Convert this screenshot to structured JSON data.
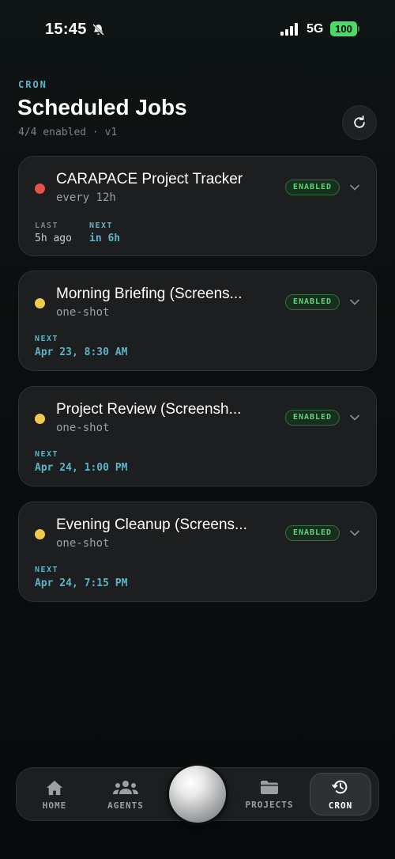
{
  "status_bar": {
    "time": "15:45",
    "network": "5G",
    "battery": "100"
  },
  "header": {
    "eyebrow": "CRON",
    "title": "Scheduled Jobs",
    "subtitle": "4/4 enabled · v1"
  },
  "jobs": [
    {
      "name": "CARAPACE Project Tracker",
      "schedule": "every 12h",
      "status": "ENABLED",
      "dot_color": "#e5534b",
      "last_label": "LAST",
      "last_value": "5h ago",
      "next_label": "NEXT",
      "next_value": "in 6h"
    },
    {
      "name": "Morning Briefing (Screens...",
      "schedule": "one-shot",
      "status": "ENABLED",
      "dot_color": "#f2c94c",
      "next_label": "NEXT",
      "next_value": "Apr 23, 8:30 AM"
    },
    {
      "name": "Project Review (Screensh...",
      "schedule": "one-shot",
      "status": "ENABLED",
      "dot_color": "#f2c94c",
      "next_label": "NEXT",
      "next_value": "Apr 24, 1:00 PM"
    },
    {
      "name": "Evening Cleanup (Screens...",
      "schedule": "one-shot",
      "status": "ENABLED",
      "dot_color": "#f2c94c",
      "next_label": "NEXT",
      "next_value": "Apr 24, 7:15 PM"
    }
  ],
  "tabbar": {
    "home": {
      "label": "HOME",
      "icon": "home-icon"
    },
    "agents": {
      "label": "AGENTS",
      "icon": "people-icon"
    },
    "projects": {
      "label": "PROJECTS",
      "icon": "folder-icon"
    },
    "cron": {
      "label": "CRON",
      "icon": "clock-refresh-icon",
      "active": true
    }
  },
  "colors": {
    "accent": "#5fb3c7",
    "enabled": "#5fd57a",
    "error_dot": "#e5534b",
    "pending_dot": "#f2c94c"
  }
}
